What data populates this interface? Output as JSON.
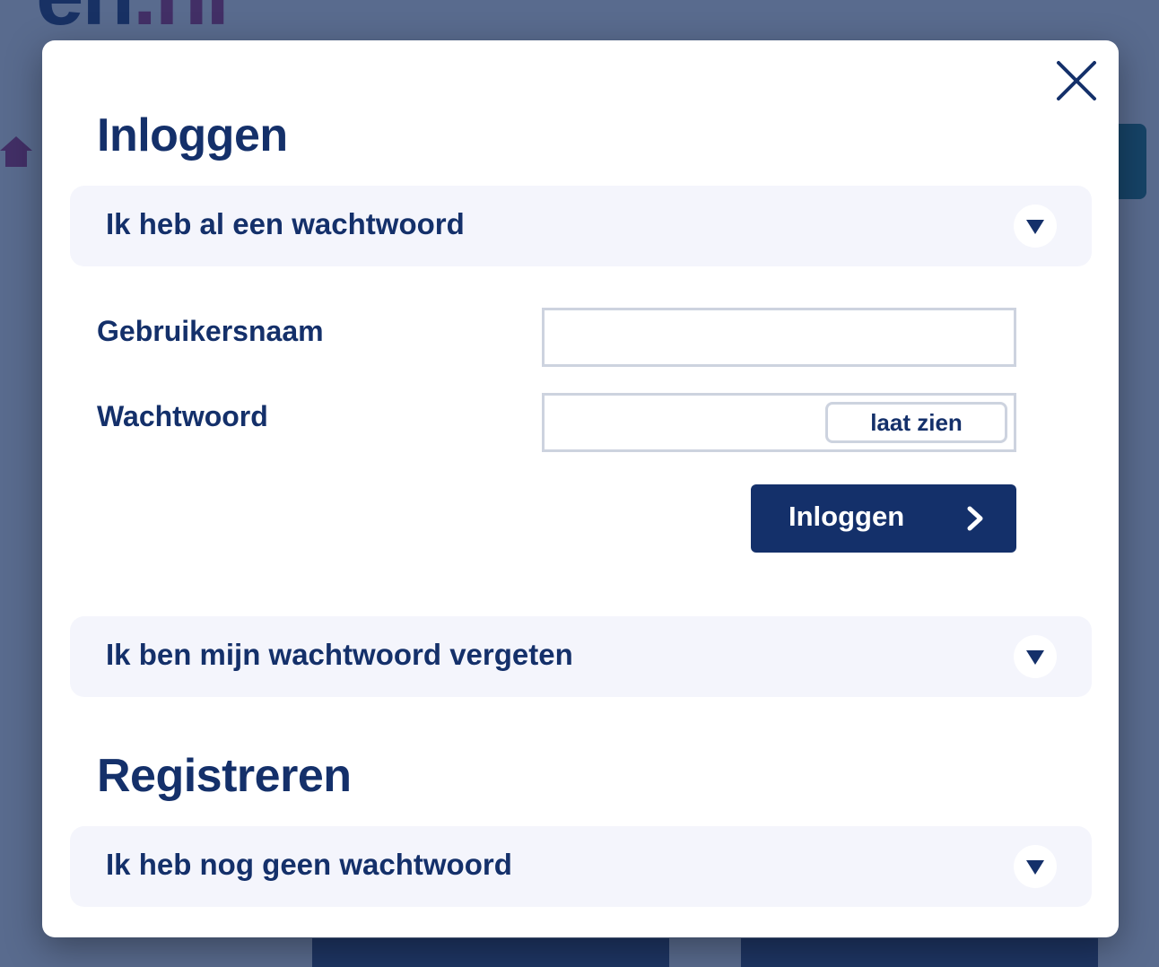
{
  "modal": {
    "login_title": "Inloggen",
    "accordions": [
      {
        "label": "Ik heb al een wachtwoord"
      },
      {
        "label": "Ik ben mijn wachtwoord vergeten"
      },
      {
        "label": "Ik heb nog geen wachtwoord"
      }
    ],
    "form": {
      "username_label": "Gebruikersnaam",
      "username_value": "",
      "password_label": "Wachtwoord",
      "password_value": "",
      "show_password_label": "laat zien",
      "submit_label": "Inloggen"
    },
    "register_title": "Registreren"
  },
  "icons": {
    "close": "close-icon",
    "toggle": "triangle-down-icon",
    "submit": "chevron-right-icon"
  },
  "colors": {
    "brand_navy": "#14306a",
    "accordion_bg": "#f4f5fc",
    "input_border": "#cdd3df",
    "overlay": "#5c6f8f"
  }
}
